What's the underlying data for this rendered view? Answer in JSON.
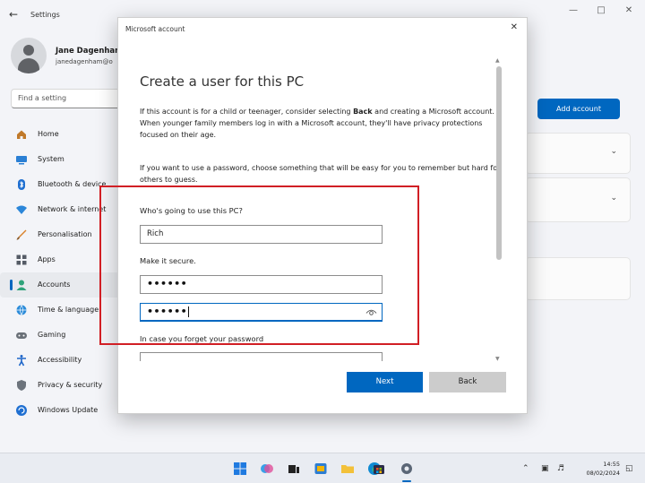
{
  "settings": {
    "title": "Settings",
    "profile": {
      "name": "Jane Dagenham",
      "email": "janedagenham@o"
    },
    "search_placeholder": "Find a setting",
    "nav": [
      {
        "label": "Home",
        "icon": "home-icon"
      },
      {
        "label": "System",
        "icon": "monitor-icon"
      },
      {
        "label": "Bluetooth & device",
        "icon": "bluetooth-icon"
      },
      {
        "label": "Network & internet",
        "icon": "wifi-icon"
      },
      {
        "label": "Personalisation",
        "icon": "brush-icon"
      },
      {
        "label": "Apps",
        "icon": "apps-icon"
      },
      {
        "label": "Accounts",
        "icon": "accounts-icon"
      },
      {
        "label": "Time & language",
        "icon": "globe-icon"
      },
      {
        "label": "Gaming",
        "icon": "gamepad-icon"
      },
      {
        "label": "Accessibility",
        "icon": "accessibility-icon"
      },
      {
        "label": "Privacy & security",
        "icon": "shield-icon"
      },
      {
        "label": "Windows Update",
        "icon": "update-icon"
      }
    ],
    "active_nav": "Accounts",
    "add_account_label": "Add account"
  },
  "dialog": {
    "title": "Microsoft account",
    "heading": "Create a user for this PC",
    "intro_pre": "If this account is for a child or teenager, consider selecting ",
    "intro_bold": "Back",
    "intro_post": " and creating a Microsoft account. When younger family members log in with a Microsoft account, they'll have privacy protections focused on their age.",
    "password_hint": "If you want to use a password, choose something that will be easy for you to remember but hard for others to guess.",
    "who_label": "Who's going to use this PC?",
    "username_value": "Rich",
    "secure_label": "Make it secure.",
    "password_value": "••••••",
    "confirm_value": "••••••",
    "forget_label": "In case you forget your password",
    "next_label": "Next",
    "back_label": "Back"
  },
  "colors": {
    "accent": "#0067c0",
    "highlight": "#d11f25"
  },
  "taskbar": {
    "icons": [
      "windows-start-icon",
      "copilot-icon",
      "task-view-icon",
      "widgets-icon",
      "file-explorer-icon",
      "edge-icon",
      "store-icon",
      "settings-icon"
    ],
    "time": "14:55",
    "date": "08/02/2024"
  }
}
